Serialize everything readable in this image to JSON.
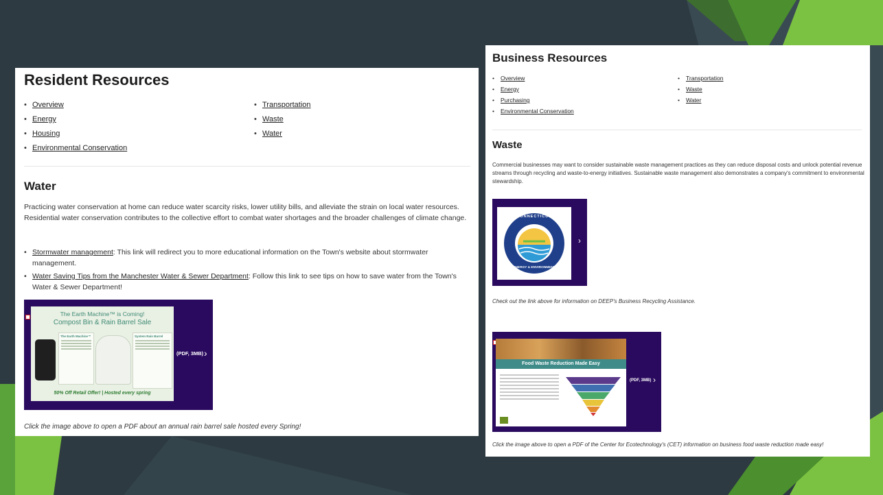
{
  "resident": {
    "title": "Resident Resources",
    "nav_col1": [
      "Overview",
      "Energy",
      "Housing",
      "Environmental Conservation"
    ],
    "nav_col2": [
      "Transportation",
      "Waste",
      "Water"
    ],
    "section_title": "Water",
    "paragraph": "Practicing water conservation at home can reduce water scarcity risks, lower utility bills, and alleviate the strain on local water resources. Residential water conservation contributes to the collective effort to combat water shortages and the broader challenges of climate change.",
    "links": [
      {
        "link": "Stormwater management",
        "text": ": This link will redirect you to more educational information on the Town's website about stormwater management."
      },
      {
        "link": "Water Saving Tips from the Manchester Water & Sewer Department",
        "text": ": Follow this link to see tips on how to save water from the Town's Water & Sewer Department!"
      }
    ],
    "flyer": {
      "headline": "The Earth Machine™ is Coming!",
      "subheadline": "Compost Bin & Rain Barrel Sale",
      "col1_title": "The Earth Machine™",
      "col2_title": "System Rain Barrel",
      "footer": "50% Off Retail Offer! | Hosted every spring",
      "pdf_label": "(PDF, 3MB)"
    },
    "caption": "Click the image above to open a PDF about an annual rain barrel sale hosted every Spring!"
  },
  "business": {
    "title": "Business Resources",
    "nav_col1": [
      "Overview",
      "Energy",
      "Purchasing",
      "Environmental Conservation"
    ],
    "nav_col2": [
      "Transportation",
      "Waste",
      "Water"
    ],
    "section_title": "Waste",
    "paragraph": "Commercial businesses may want to consider sustainable waste management practices as they can reduce disposal costs and unlock potential revenue streams through recycling and waste-to-energy initiatives. Sustainable waste management also demonstrates a company's commitment to environmental stewardship.",
    "logo": {
      "top_text": "CONNECTICUT",
      "bottom_text": "ENERGY & ENVIRONMENT"
    },
    "caption1": "Check out the link above for information on DEEP's Business Recycling Assistance.",
    "food": {
      "banner": "Food Waste Reduction Made Easy",
      "pdf_label": "(PDF, 3MB)"
    },
    "caption2": "Click the image above to open a PDF of the Center for Ecotechnology's (CET) information on business food waste reduction made easy!"
  },
  "colors": {
    "background": "#2d3a41",
    "accent_green": "#7cc242",
    "carousel": "#2a0a5e"
  }
}
